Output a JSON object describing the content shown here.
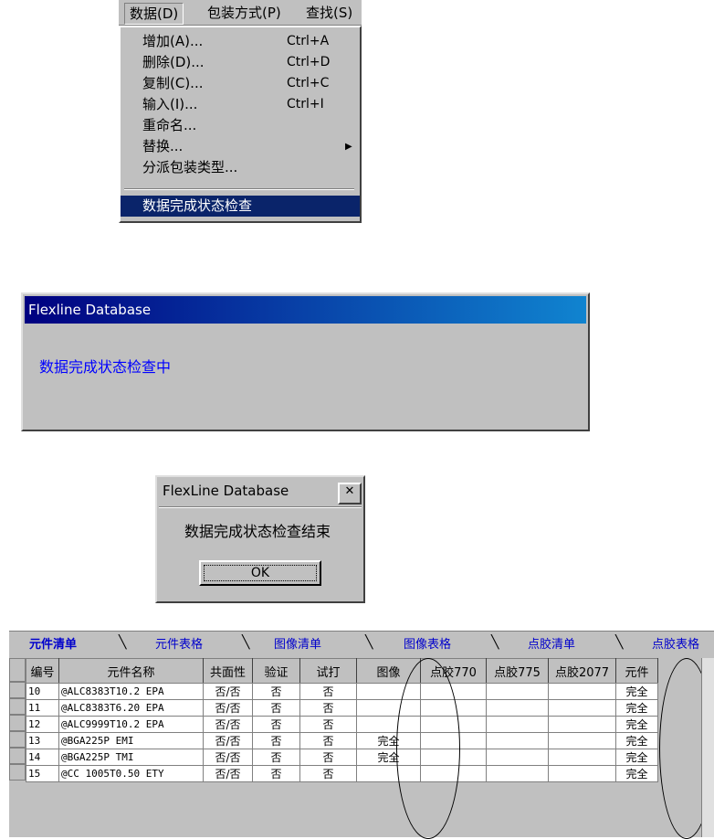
{
  "menubar": [
    {
      "label": "数据(D)",
      "active": true
    },
    {
      "label": "包装方式(P)"
    },
    {
      "label": "查找(S)"
    }
  ],
  "dropdown": [
    {
      "label": "增加(A)...",
      "shortcut": "Ctrl+A"
    },
    {
      "label": "删除(D)...",
      "shortcut": "Ctrl+D"
    },
    {
      "label": "复制(C)...",
      "shortcut": "Ctrl+C"
    },
    {
      "label": "输入(I)...",
      "shortcut": "Ctrl+I"
    },
    {
      "label": "重命名...",
      "shortcut": ""
    },
    {
      "label": "替换...",
      "shortcut": "",
      "submenu": true
    },
    {
      "label": "分派包装类型...",
      "shortcut": ""
    },
    {
      "label": "数据完成状态检查",
      "shortcut": "",
      "highlighted": true
    }
  ],
  "dialog1": {
    "title": "Flexline Database",
    "message": "数据完成状态检查中"
  },
  "dialog2": {
    "title": "FlexLine Database",
    "message": "数据完成状态检查结束",
    "ok_label": "OK",
    "close_glyph": "✕"
  },
  "tabs": [
    {
      "label": "元件清单",
      "active": true
    },
    {
      "label": "元件表格"
    },
    {
      "label": "图像清单"
    },
    {
      "label": "图像表格"
    },
    {
      "label": "点胶清单"
    },
    {
      "label": "点胶表格"
    }
  ],
  "table": {
    "headers": [
      "编号",
      "元件名称",
      "共面性",
      "验证",
      "试打",
      "图像",
      "点胶770",
      "点胶775",
      "点胶2077",
      "元件"
    ],
    "rows": [
      [
        "10",
        "@ALC8383T10.2     EPA",
        "否/否",
        "否",
        "否",
        "",
        "",
        "",
        "",
        "完全"
      ],
      [
        "11",
        "@ALC8383T6.20     EPA",
        "否/否",
        "否",
        "否",
        "",
        "",
        "",
        "",
        "完全"
      ],
      [
        "12",
        "@ALC9999T10.2     EPA",
        "否/否",
        "否",
        "否",
        "",
        "",
        "",
        "",
        "完全"
      ],
      [
        "13",
        "@BGA225P          EMI",
        "否/否",
        "否",
        "否",
        "完全",
        "",
        "",
        "",
        "完全"
      ],
      [
        "14",
        "@BGA225P          TMI",
        "否/否",
        "否",
        "否",
        "完全",
        "",
        "",
        "",
        "完全"
      ],
      [
        "15",
        "@CC 1005T0.50     ETY",
        "否/否",
        "否",
        "否",
        "",
        "",
        "",
        "",
        "完全"
      ]
    ]
  },
  "colors": {
    "menu_bg": "#c0c0c0",
    "highlight": "#0a246a",
    "title_gradient_start": "#000080",
    "title_gradient_end": "#1084d0",
    "tab_text": "#0000cc",
    "message_blue": "#0000ff"
  }
}
